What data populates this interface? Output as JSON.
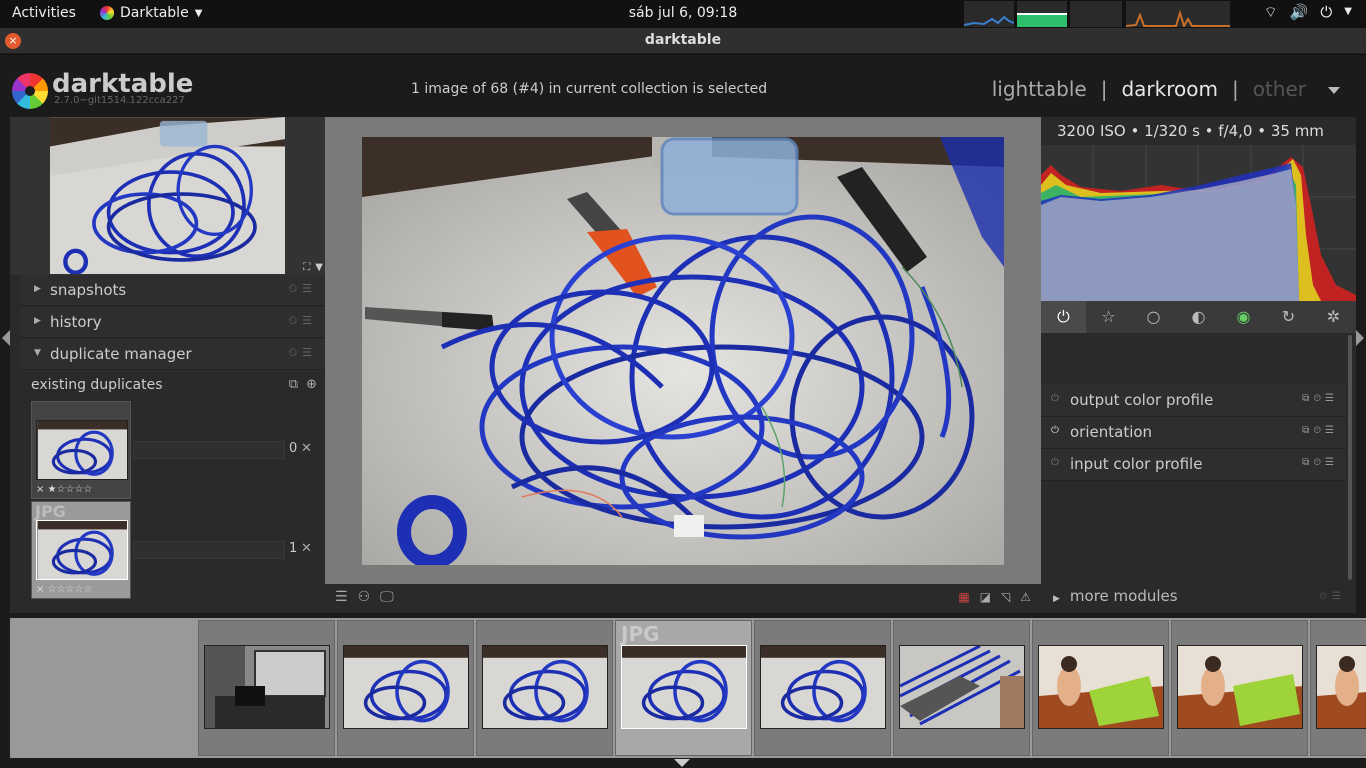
{
  "topbar": {
    "activities": "Activities",
    "app": "Darktable",
    "clock": "sáb jul  6, 09:18"
  },
  "window": {
    "title": "darktable",
    "close": "×"
  },
  "header": {
    "app_name": "darktable",
    "version": "2.7.0~git1514.122cca227",
    "collection_info": "1 image of 68 (#4) in current collection is selected",
    "views": {
      "lighttable": "lighttable",
      "sep": "|",
      "darkroom": "darkroom",
      "other": "other"
    }
  },
  "left": {
    "modules": [
      {
        "label": "snapshots",
        "arrow": "▶"
      },
      {
        "label": "history",
        "arrow": "▶"
      },
      {
        "label": "duplicate manager",
        "arrow": "▼"
      }
    ],
    "duplicates": {
      "title": "existing duplicates",
      "items": [
        {
          "num": "0",
          "stars": "× ★☆☆☆☆",
          "badge": ""
        },
        {
          "num": "1",
          "stars": "× ☆☆☆☆☆",
          "badge": "JPG"
        }
      ],
      "remove": "✕"
    }
  },
  "right": {
    "exif": "3200 ISO • 1/320 s • f/4,0 • 35 mm",
    "groups": [
      "⏻",
      "☆",
      "○",
      "◐",
      "◉",
      "↻",
      "✲"
    ],
    "modules": [
      {
        "label": "output color profile",
        "on": false
      },
      {
        "label": "orientation",
        "on": true
      },
      {
        "label": "input color profile",
        "on": false
      }
    ],
    "more_modules": "more modules",
    "more_arrow": "▶"
  },
  "filmstrip": {
    "selected_badge": "JPG"
  },
  "colors": {
    "accent_close": "#e25a2d",
    "background": "#1b1b1b",
    "panel": "#2a2a2a",
    "wire": "#1d2fb5"
  }
}
